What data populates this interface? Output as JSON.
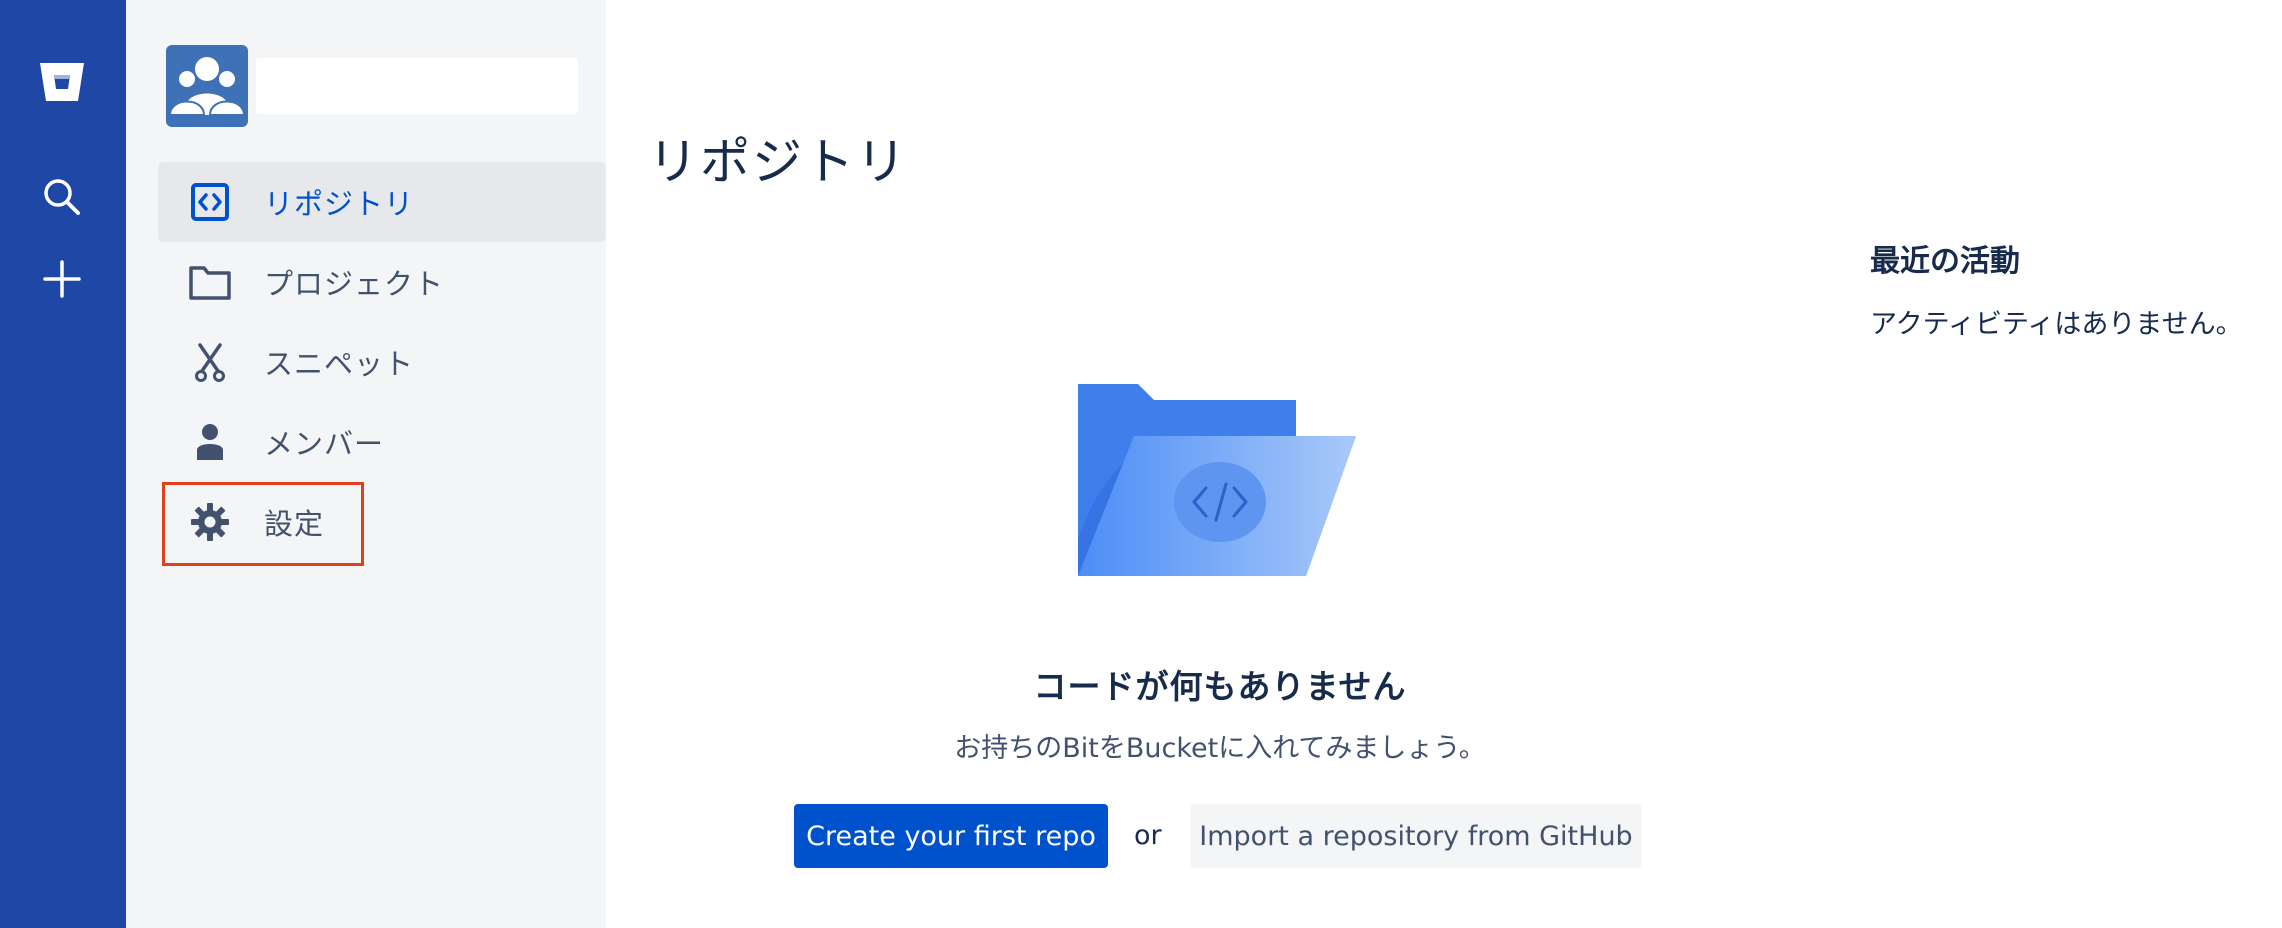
{
  "global_nav": {
    "logo_icon": "bitbucket-logo-icon",
    "search_icon": "search-icon",
    "create_icon": "plus-icon"
  },
  "sidebar": {
    "items": [
      {
        "label": "リポジトリ",
        "icon": "repository-icon",
        "selected": true
      },
      {
        "label": "プロジェクト",
        "icon": "folder-icon",
        "selected": false
      },
      {
        "label": "スニペット",
        "icon": "scissors-icon",
        "selected": false
      },
      {
        "label": "メンバー",
        "icon": "person-icon",
        "selected": false
      },
      {
        "label": "設定",
        "icon": "gear-icon",
        "selected": false
      }
    ]
  },
  "main": {
    "title": "リポジトリ",
    "empty_state": {
      "heading": "コードが何もありません",
      "subtext": "お持ちのBitをBucketに入れてみましょう。",
      "primary_button": "Create your first repo",
      "or_text": "or",
      "secondary_button": "Import a repository from GitHub"
    }
  },
  "activity": {
    "title": "最近の活動",
    "empty_text": "アクティビティはありません。"
  },
  "colors": {
    "global_nav_bg": "#1E47A6",
    "sidebar_bg": "#F4F5F7",
    "primary": "#0052CC",
    "highlight_border": "#E0401F"
  }
}
